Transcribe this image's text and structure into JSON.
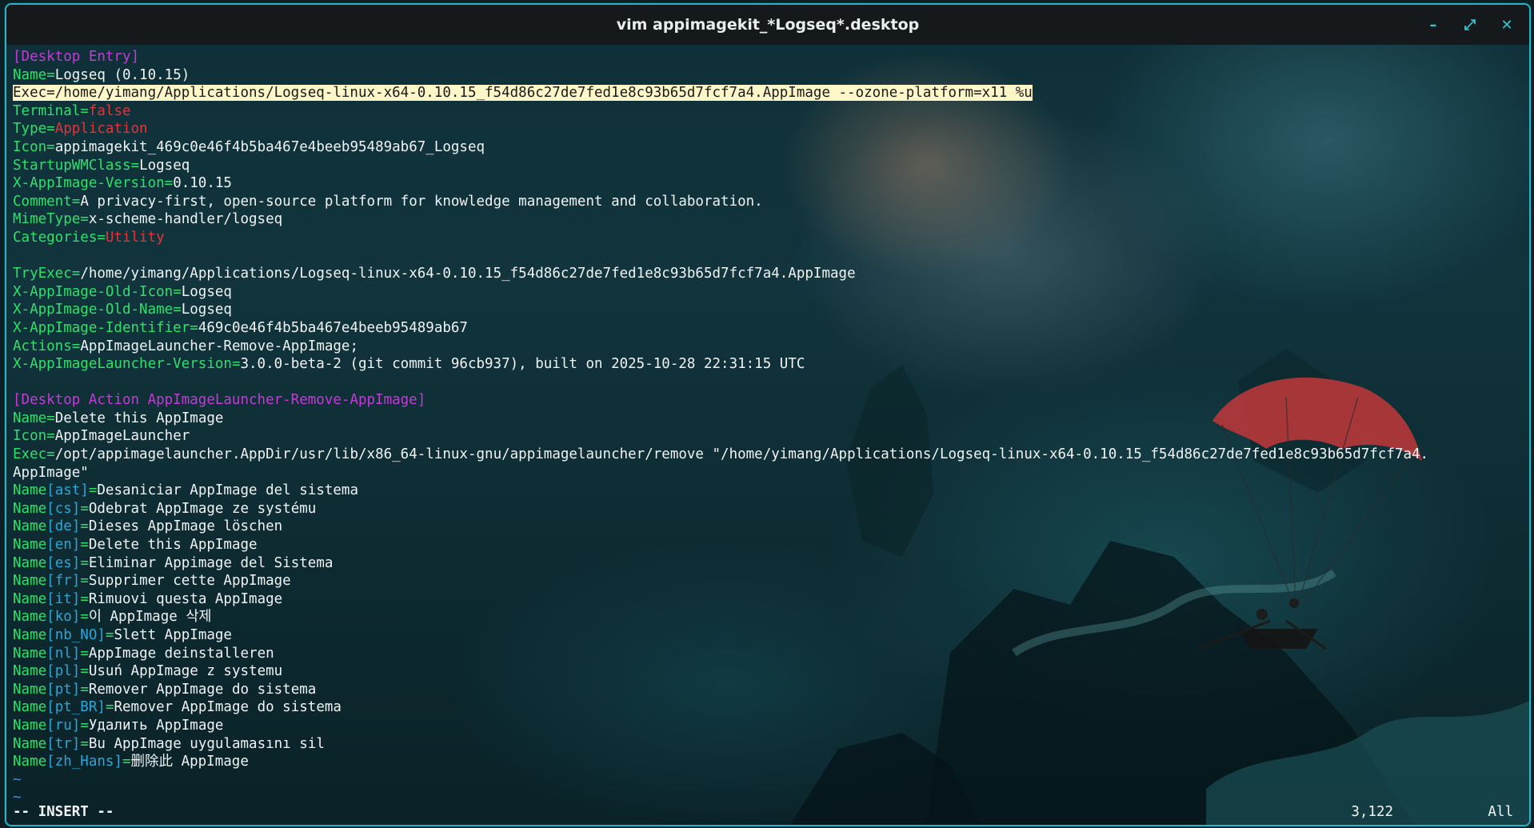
{
  "window": {
    "title": "vim appimagekit_*Logseq*.desktop",
    "accent_color": "#2ab3c2",
    "controls": [
      {
        "name": "minimize-icon",
        "glyph": "–"
      },
      {
        "name": "maximize-icon",
        "glyph": "⤢"
      },
      {
        "name": "close-icon",
        "glyph": "✕"
      }
    ]
  },
  "editor": {
    "lines": [
      [
        {
          "t": "[Desktop Entry]",
          "c": "sec"
        }
      ],
      [
        {
          "t": "Name",
          "c": "k"
        },
        {
          "t": "=",
          "c": "eq"
        },
        {
          "t": "Logseq (0.10.15)",
          "c": "v"
        }
      ],
      [
        {
          "t": "Exec=/home/yimang/Applications/Logseq-linux-x64-0.10.15_f54d86c27de7fed1e8c93b65d7fcf7a4.AppImage --ozone-platform=x11 %u",
          "c": "hl"
        }
      ],
      [
        {
          "t": "Terminal",
          "c": "k"
        },
        {
          "t": "=",
          "c": "eq"
        },
        {
          "t": "false",
          "c": "red"
        }
      ],
      [
        {
          "t": "Type",
          "c": "k"
        },
        {
          "t": "=",
          "c": "eq"
        },
        {
          "t": "Application",
          "c": "red"
        }
      ],
      [
        {
          "t": "Icon",
          "c": "k"
        },
        {
          "t": "=",
          "c": "eq"
        },
        {
          "t": "appimagekit_469c0e46f4b5ba467e4beeb95489ab67_Logseq",
          "c": "v"
        }
      ],
      [
        {
          "t": "StartupWMClass",
          "c": "k"
        },
        {
          "t": "=",
          "c": "eq"
        },
        {
          "t": "Logseq",
          "c": "v"
        }
      ],
      [
        {
          "t": "X-AppImage-Version",
          "c": "k"
        },
        {
          "t": "=",
          "c": "eq"
        },
        {
          "t": "0.10.15",
          "c": "v"
        }
      ],
      [
        {
          "t": "Comment",
          "c": "k"
        },
        {
          "t": "=",
          "c": "eq"
        },
        {
          "t": "A privacy-first, open-source platform for knowledge management and collaboration.",
          "c": "v"
        }
      ],
      [
        {
          "t": "MimeType",
          "c": "k"
        },
        {
          "t": "=",
          "c": "eq"
        },
        {
          "t": "x-scheme-handler/logseq",
          "c": "v"
        }
      ],
      [
        {
          "t": "Categories",
          "c": "k"
        },
        {
          "t": "=",
          "c": "eq"
        },
        {
          "t": "Utility",
          "c": "red"
        }
      ],
      [],
      [
        {
          "t": "TryExec",
          "c": "k"
        },
        {
          "t": "=",
          "c": "eq"
        },
        {
          "t": "/home/yimang/Applications/Logseq-linux-x64-0.10.15_f54d86c27de7fed1e8c93b65d7fcf7a4.AppImage",
          "c": "v"
        }
      ],
      [
        {
          "t": "X-AppImage-Old-Icon",
          "c": "k"
        },
        {
          "t": "=",
          "c": "eq"
        },
        {
          "t": "Logseq",
          "c": "v"
        }
      ],
      [
        {
          "t": "X-AppImage-Old-Name",
          "c": "k"
        },
        {
          "t": "=",
          "c": "eq"
        },
        {
          "t": "Logseq",
          "c": "v"
        }
      ],
      [
        {
          "t": "X-AppImage-Identifier",
          "c": "k"
        },
        {
          "t": "=",
          "c": "eq"
        },
        {
          "t": "469c0e46f4b5ba467e4beeb95489ab67",
          "c": "v"
        }
      ],
      [
        {
          "t": "Actions",
          "c": "k"
        },
        {
          "t": "=",
          "c": "eq"
        },
        {
          "t": "AppImageLauncher-Remove-AppImage;",
          "c": "v"
        }
      ],
      [
        {
          "t": "X-AppImageLauncher-Version",
          "c": "k"
        },
        {
          "t": "=",
          "c": "eq"
        },
        {
          "t": "3.0.0-beta-2 (git commit 96cb937), built on 2025-10-28 22:31:15 UTC",
          "c": "v"
        }
      ],
      [],
      [
        {
          "t": "[Desktop Action AppImageLauncher-Remove-AppImage]",
          "c": "sec"
        }
      ],
      [
        {
          "t": "Name",
          "c": "k"
        },
        {
          "t": "=",
          "c": "eq"
        },
        {
          "t": "Delete this AppImage",
          "c": "v"
        }
      ],
      [
        {
          "t": "Icon",
          "c": "k"
        },
        {
          "t": "=",
          "c": "eq"
        },
        {
          "t": "AppImageLauncher",
          "c": "v"
        }
      ],
      [
        {
          "t": "Exec",
          "c": "k"
        },
        {
          "t": "=",
          "c": "eq"
        },
        {
          "t": "/opt/appimagelauncher.AppDir/usr/lib/x86_64-linux-gnu/appimagelauncher/remove \"/home/yimang/Applications/Logseq-linux-x64-0.10.15_f54d86c27de7fed1e8c93b65d7fcf7a4.",
          "c": "v"
        }
      ],
      [
        {
          "t": "AppImage\"",
          "c": "v"
        }
      ],
      [
        {
          "t": "Name",
          "c": "k"
        },
        {
          "t": "[ast]",
          "c": "loc"
        },
        {
          "t": "=",
          "c": "eq"
        },
        {
          "t": "Desaniciar AppImage del sistema",
          "c": "v"
        }
      ],
      [
        {
          "t": "Name",
          "c": "k"
        },
        {
          "t": "[cs]",
          "c": "loc"
        },
        {
          "t": "=",
          "c": "eq"
        },
        {
          "t": "Odebrat AppImage ze systému",
          "c": "v"
        }
      ],
      [
        {
          "t": "Name",
          "c": "k"
        },
        {
          "t": "[de]",
          "c": "loc"
        },
        {
          "t": "=",
          "c": "eq"
        },
        {
          "t": "Dieses AppImage löschen",
          "c": "v"
        }
      ],
      [
        {
          "t": "Name",
          "c": "k"
        },
        {
          "t": "[en]",
          "c": "loc"
        },
        {
          "t": "=",
          "c": "eq"
        },
        {
          "t": "Delete this AppImage",
          "c": "v"
        }
      ],
      [
        {
          "t": "Name",
          "c": "k"
        },
        {
          "t": "[es]",
          "c": "loc"
        },
        {
          "t": "=",
          "c": "eq"
        },
        {
          "t": "Eliminar Appimage del Sistema",
          "c": "v"
        }
      ],
      [
        {
          "t": "Name",
          "c": "k"
        },
        {
          "t": "[fr]",
          "c": "loc"
        },
        {
          "t": "=",
          "c": "eq"
        },
        {
          "t": "Supprimer cette AppImage",
          "c": "v"
        }
      ],
      [
        {
          "t": "Name",
          "c": "k"
        },
        {
          "t": "[it]",
          "c": "loc"
        },
        {
          "t": "=",
          "c": "eq"
        },
        {
          "t": "Rimuovi questa AppImage",
          "c": "v"
        }
      ],
      [
        {
          "t": "Name",
          "c": "k"
        },
        {
          "t": "[ko]",
          "c": "loc"
        },
        {
          "t": "=",
          "c": "eq"
        },
        {
          "t": "이 AppImage 삭제",
          "c": "v"
        }
      ],
      [
        {
          "t": "Name",
          "c": "k"
        },
        {
          "t": "[nb_NO]",
          "c": "loc"
        },
        {
          "t": "=",
          "c": "eq"
        },
        {
          "t": "Slett AppImage",
          "c": "v"
        }
      ],
      [
        {
          "t": "Name",
          "c": "k"
        },
        {
          "t": "[nl]",
          "c": "loc"
        },
        {
          "t": "=",
          "c": "eq"
        },
        {
          "t": "AppImage deinstalleren",
          "c": "v"
        }
      ],
      [
        {
          "t": "Name",
          "c": "k"
        },
        {
          "t": "[pl]",
          "c": "loc"
        },
        {
          "t": "=",
          "c": "eq"
        },
        {
          "t": "Usuń AppImage z systemu",
          "c": "v"
        }
      ],
      [
        {
          "t": "Name",
          "c": "k"
        },
        {
          "t": "[pt]",
          "c": "loc"
        },
        {
          "t": "=",
          "c": "eq"
        },
        {
          "t": "Remover AppImage do sistema",
          "c": "v"
        }
      ],
      [
        {
          "t": "Name",
          "c": "k"
        },
        {
          "t": "[pt_BR]",
          "c": "loc"
        },
        {
          "t": "=",
          "c": "eq"
        },
        {
          "t": "Remover AppImage do sistema",
          "c": "v"
        }
      ],
      [
        {
          "t": "Name",
          "c": "k"
        },
        {
          "t": "[ru]",
          "c": "loc"
        },
        {
          "t": "=",
          "c": "eq"
        },
        {
          "t": "Удалить AppImage",
          "c": "v"
        }
      ],
      [
        {
          "t": "Name",
          "c": "k"
        },
        {
          "t": "[tr]",
          "c": "loc"
        },
        {
          "t": "=",
          "c": "eq"
        },
        {
          "t": "Bu AppImage uygulamasını sil",
          "c": "v"
        }
      ],
      [
        {
          "t": "Name",
          "c": "k"
        },
        {
          "t": "[zh_Hans]",
          "c": "loc"
        },
        {
          "t": "=",
          "c": "eq"
        },
        {
          "t": "删除此 AppImage",
          "c": "v"
        }
      ],
      [
        {
          "t": "~",
          "c": "tilde"
        }
      ],
      [
        {
          "t": "~",
          "c": "tilde"
        }
      ]
    ]
  },
  "status": {
    "mode": "-- INSERT --",
    "cursor_position": "3,122",
    "scroll": "All"
  },
  "colors": {
    "key": "#2ee06b",
    "value": "#f0f3f4",
    "keyword_value": "#e8323a",
    "section": "#c43ad6",
    "locale": "#2aa6d8",
    "highlight": "#fff7c8"
  }
}
